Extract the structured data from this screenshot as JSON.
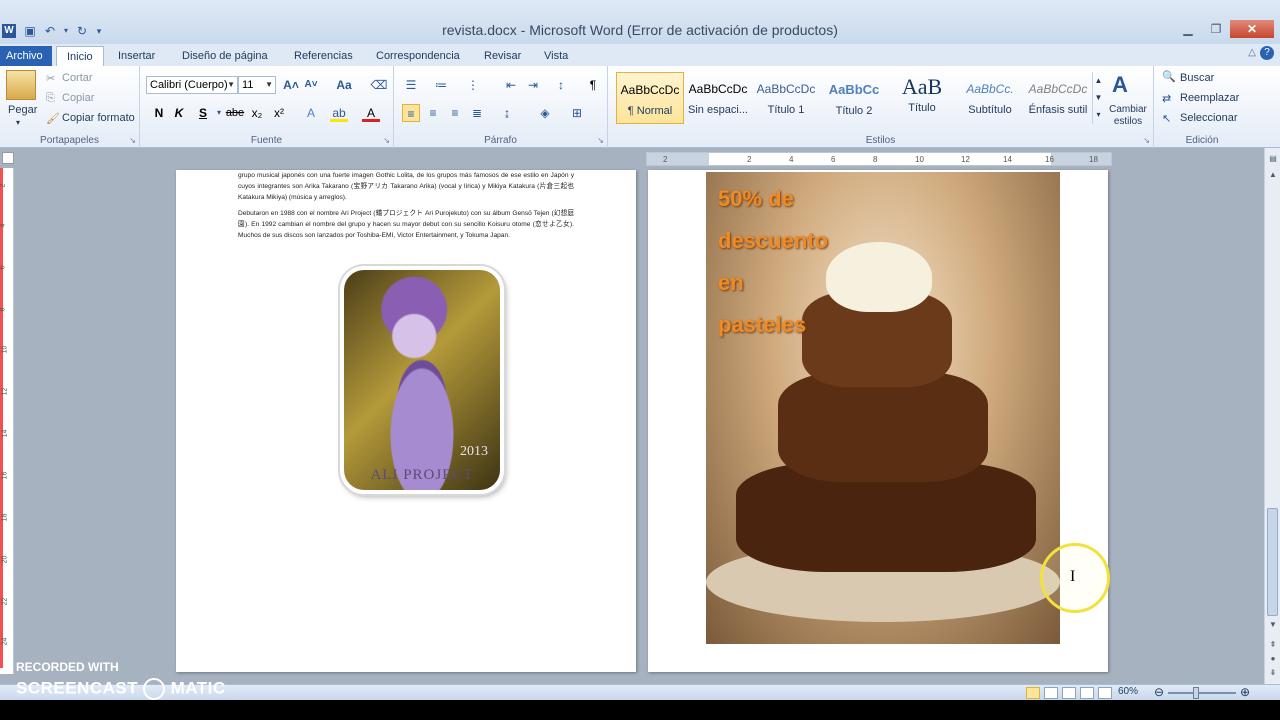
{
  "window": {
    "title": "revista.docx - Microsoft Word (Error de activación de productos)",
    "app_icon": "W"
  },
  "tabs": [
    "Archivo",
    "Inicio",
    "Insertar",
    "Diseño de página",
    "Referencias",
    "Correspondencia",
    "Revisar",
    "Vista"
  ],
  "active_tab": "Inicio",
  "ribbon": {
    "clipboard": {
      "paste": "Pegar",
      "cut": "Cortar",
      "copy": "Copiar",
      "format_painter": "Copiar formato",
      "label": "Portapapeles"
    },
    "font": {
      "font_name": "Calibri (Cuerpo)",
      "font_size": "11",
      "change_case": "Aa",
      "bold": "N",
      "italic": "K",
      "underline": "S",
      "strikethrough": "abe",
      "subscript": "x₂",
      "superscript": "x²",
      "label": "Fuente"
    },
    "paragraph": {
      "label": "Párrafo"
    },
    "styles": {
      "items": [
        {
          "sample": "AaBbCcDc",
          "name": "¶ Normal"
        },
        {
          "sample": "AaBbCcDc",
          "name": "Sin espaci..."
        },
        {
          "sample": "AaBbCcDc",
          "name": "Título 1"
        },
        {
          "sample": "AaBbCc",
          "name": "Título 2"
        },
        {
          "sample": "AaB",
          "name": "Título"
        },
        {
          "sample": "AaBbCc.",
          "name": "Subtítulo"
        },
        {
          "sample": "AaBbCcDc",
          "name": "Énfasis sutil"
        }
      ],
      "change_styles": "Cambiar estilos",
      "label": "Estilos"
    },
    "editing": {
      "find": "Buscar",
      "replace": "Reemplazar",
      "select": "Seleccionar",
      "label": "Edición"
    }
  },
  "ruler": {
    "h_ticks": [
      "2",
      "2",
      "4",
      "6",
      "8",
      "10",
      "12",
      "14",
      "16",
      "18"
    ],
    "v_ticks": [
      "2",
      "4",
      "6",
      "8",
      "10",
      "12",
      "14",
      "16",
      "18",
      "20",
      "22",
      "24"
    ]
  },
  "page1": {
    "para1": "grupo musical japonés con una fuerte imagen Gothic Lolita, de los grupos más famosos de ese estilo en Japón y cuyos integrantes son Arika Takarano (宝野アリカ Takarano Arika) (vocal y lírica) y Mikiya Katakura (片倉三起也 Katakura Mikiya) (música y arreglos).",
    "para2": "Debutaron en 1988 con el nombre Ari Project (蟻プロジェクト Ari Purojekuto) con su álbum Gensō Tejen (幻想庭園). En 1992 cambian el nombre del grupo y hacen su mayor debut con su sencillo Koisuru otome (恋せよ乙女). Muchos de sus discos son lanzados por Toshiba-EMI, Victor Entertainment, y Tokuma Japan.",
    "photo_year": "2013",
    "photo_caption": "ALI PROJECT"
  },
  "page2": {
    "promo_lines": [
      "50% de",
      "descuento",
      "en",
      "pasteles"
    ]
  },
  "statusbar": {
    "zoom": "60%"
  },
  "watermark": {
    "line1": "RECORDED WITH",
    "line2": "SCREENCAST",
    "line2b": "MATIC"
  }
}
